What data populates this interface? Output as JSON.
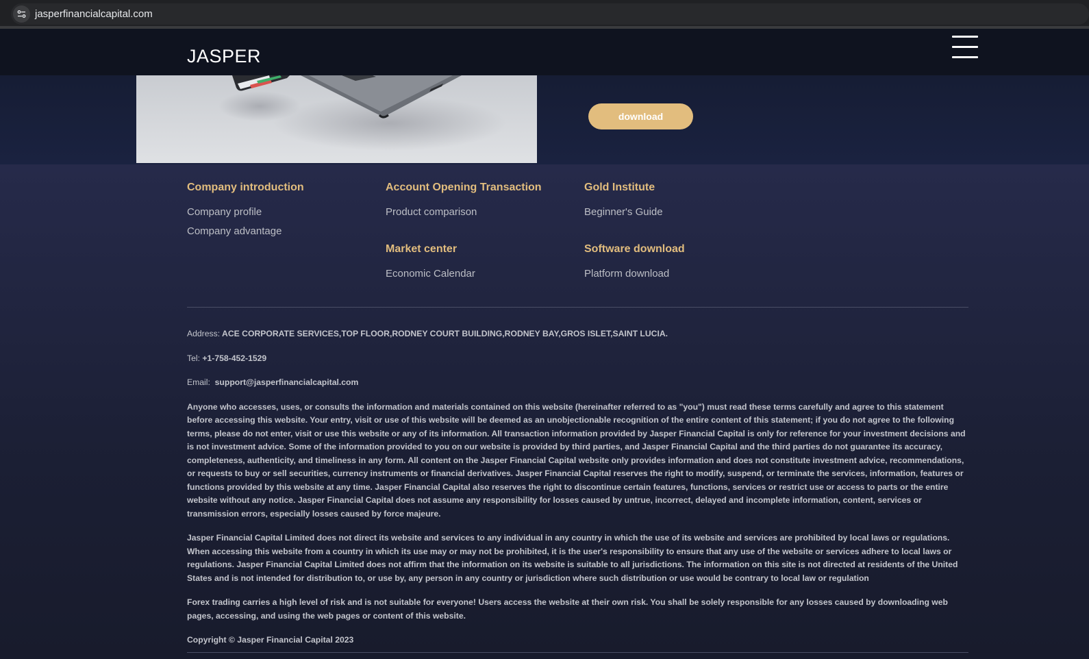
{
  "browser": {
    "url": "jasperfinancialcapital.com"
  },
  "header": {
    "logo": "JASPER"
  },
  "hero": {
    "download_label": "download"
  },
  "footer": {
    "columns": [
      {
        "title": "Company introduction",
        "links": [
          "Company profile",
          "Company advantage"
        ]
      },
      {
        "title": "Account Opening Transaction",
        "links": [
          "Product comparison"
        ]
      },
      {
        "title": "Gold Institute",
        "links": [
          "Beginner's Guide"
        ]
      },
      {
        "title": "Market center",
        "links": [
          "Economic Calendar"
        ]
      },
      {
        "title": "Software download",
        "links": [
          "Platform download"
        ]
      }
    ],
    "address_label": "Address:",
    "address": "ACE CORPORATE SERVICES,TOP FLOOR,RODNEY COURT BUILDING,RODNEY BAY,GROS ISLET,SAINT LUCIA.",
    "tel_label": "Tel:",
    "tel": "+1-758-452-1529",
    "email_label": "Email:",
    "email": "support@jasperfinancialcapital.com",
    "disclaimer_1": "Anyone who accesses, uses, or consults the information and materials contained on this website (hereinafter referred to as \"you\") must read these terms carefully and agree to this statement before accessing this website. Your entry, visit or use of this website will be deemed as an unobjectionable recognition of the entire content of this statement; if you do not agree to the following terms, please do not enter, visit or use this website or any of its information. All transaction information provided by Jasper Financial Capital is only for reference for your investment decisions and is not investment advice. Some of the information provided to you on our website is provided by third parties, and Jasper Financial Capital and the third parties do not guarantee its accuracy, completeness, authenticity, and timeliness in any form. All content on the Jasper Financial Capital website only provides information and does not constitute investment advice, recommendations, or requests to buy or sell securities, currency instruments or financial derivatives. Jasper Financial Capital reserves the right to modify, suspend, or terminate the services, information, features or functions provided by this website at any time. Jasper Financial Capital also reserves the right to discontinue certain features, functions, services or restrict use or access to parts or the entire website without any notice. Jasper Financial Capital does not assume any responsibility for losses caused by untrue, incorrect, delayed and incomplete information, content, services or transmission errors, especially losses caused by force majeure.",
    "disclaimer_2": "Jasper Financial Capital Limited does not direct its website and services to any individual in any country in which the use of its website and services are prohibited by local laws or regulations. When accessing this website from a country in which its use may or may not be prohibited, it is the user's responsibility to ensure that any use of the website or services adhere to local laws or regulations. Jasper Financial Capital Limited does not affirm that the information on its website is suitable to all jurisdictions. The information on this site is not directed at residents of the United States and is not intended for distribution to, or use by, any person in any country or jurisdiction where such distribution or use would be contrary to local law or regulation",
    "disclaimer_3": "Forex trading carries a high level of risk and is not suitable for everyone! Users access the website at their own risk. You shall be solely responsible for any losses caused by downloading web pages, accessing, and using the web pages or content of this website.",
    "copyright": "Copyright © Jasper Financial Capital 2023"
  },
  "colors": {
    "accent_gold": "#e2bd7e",
    "header_bg": "#0f131f",
    "footer_bg": "#1c2036"
  }
}
